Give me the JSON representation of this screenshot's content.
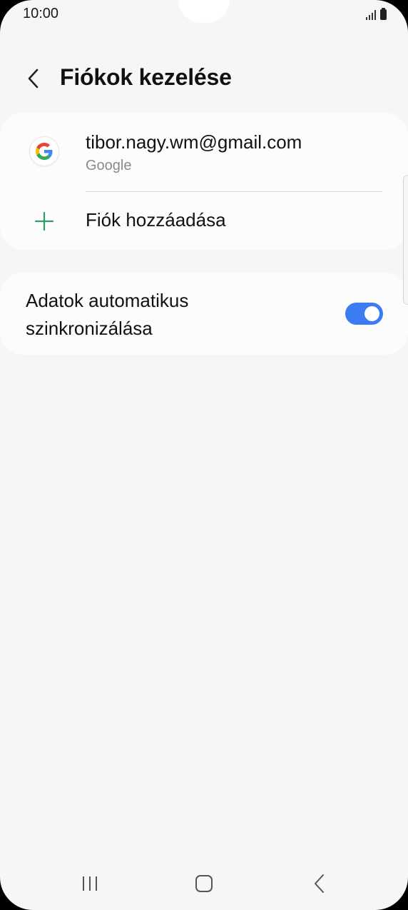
{
  "status_bar": {
    "time": "10:00",
    "icons": [
      "signal-icon",
      "battery-icon"
    ]
  },
  "header": {
    "back_icon": "chevron-left-icon",
    "title": "Fiókok kezelése"
  },
  "accounts": {
    "items": [
      {
        "icon": "google-icon",
        "email": "tibor.nagy.wm@gmail.com",
        "provider": "Google"
      }
    ],
    "add_account": {
      "icon": "plus-icon",
      "label": "Fiók hozzáadása"
    }
  },
  "sync": {
    "label": "Adatok automatikus szinkronizálása",
    "enabled": true
  },
  "nav_bar": {
    "buttons": [
      "recents-icon",
      "home-icon",
      "back-icon"
    ]
  },
  "colors": {
    "background": "#f6f6f8",
    "card": "#fcfcfd",
    "toggle_on": "#3d7bf2",
    "plus_green": "#2e9e62",
    "secondary_text": "#8a8a8e"
  }
}
